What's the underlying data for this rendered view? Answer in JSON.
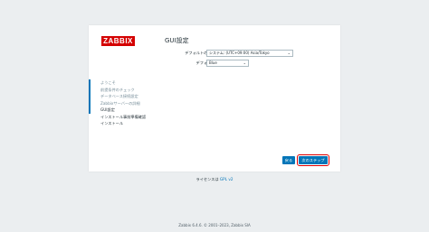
{
  "brand": {
    "logo_text": "ZABBIX",
    "accent": "#0275b8",
    "logo_color": "#d40000"
  },
  "steps": [
    {
      "label": "ようこそ",
      "state": "done"
    },
    {
      "label": "前提条件のチェック",
      "state": "done"
    },
    {
      "label": "データベース接続設定",
      "state": "done"
    },
    {
      "label": "Zabbixサーバーの詳細",
      "state": "done"
    },
    {
      "label": "GUI設定",
      "state": "current"
    },
    {
      "label": "インストール事前準備確認",
      "state": "todo"
    },
    {
      "label": "インストール",
      "state": "todo"
    }
  ],
  "main": {
    "title": "GUI設定",
    "timezone": {
      "label": "デフォルトのタイムゾーン",
      "value": "システム: (UTC+09:00) Asia/Tokyo"
    },
    "theme": {
      "label": "デフォルトのテーマ",
      "value": "Blue"
    }
  },
  "buttons": {
    "back": "戻る",
    "next": "次のステップ"
  },
  "license": {
    "prefix": "ライセンスは",
    "link": "GPL v2"
  },
  "footer": "Zabbix 6.4.6. © 2001–2023, Zabbix SIA"
}
